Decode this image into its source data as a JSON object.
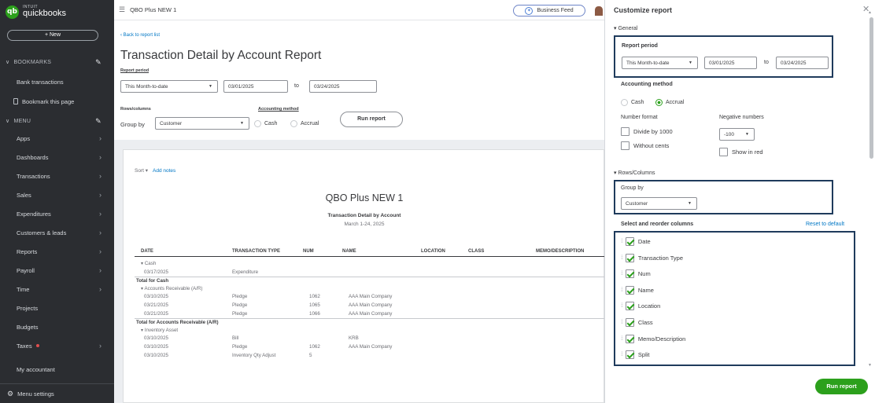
{
  "sidebar": {
    "logo_small": "INTUIT",
    "logo_main": "quickbooks",
    "new_label": "+ New",
    "bookmarks_label": "BOOKMARKS",
    "bookmarks_items": [
      "Bank transactions",
      "Bookmark this page"
    ],
    "menu_label": "MENU",
    "menu_items": [
      "Apps",
      "Dashboards",
      "Transactions",
      "Sales",
      "Expenditures",
      "Customers & leads",
      "Reports",
      "Payroll",
      "Time",
      "Projects",
      "Budgets",
      "Taxes",
      "My accountant"
    ],
    "settings_label": "Menu settings"
  },
  "topbar": {
    "company": "QBO Plus NEW 1",
    "business_feed": "Business Feed"
  },
  "report": {
    "back_link": "Back to report list",
    "title": "Transaction Detail by Account Report",
    "period_label": "Report period",
    "period_value": "This Month-to-date",
    "from_date": "03/01/2025",
    "to_label": "to",
    "to_date": "03/24/2025",
    "rows_columns_label": "Rows/columns",
    "group_by_label": "Group by",
    "group_by_value": "Customer",
    "accounting_method_label": "Accounting method",
    "cash_label": "Cash",
    "accrual_label": "Accrual",
    "run_label": "Run report",
    "sort_label": "Sort ▾",
    "add_notes": "Add notes",
    "company_name": "QBO Plus NEW 1",
    "report_name": "Transaction Detail by Account",
    "date_range": "March 1-24, 2025",
    "columns": [
      "DATE",
      "TRANSACTION TYPE",
      "NUM",
      "NAME",
      "LOCATION",
      "CLASS",
      "MEMO/DESCRIPTION"
    ],
    "rows": [
      {
        "date": "▾ Cash",
        "type": "",
        "num": "",
        "name": "",
        "kind": "group"
      },
      {
        "date": "03/17/2025",
        "type": "Expenditure",
        "num": "",
        "name": "",
        "kind": "data"
      },
      {
        "date": "Total for Cash",
        "type": "",
        "num": "",
        "name": "",
        "kind": "total"
      },
      {
        "date": "▾ Accounts Receivable (A/R)",
        "type": "",
        "num": "",
        "name": "",
        "kind": "group"
      },
      {
        "date": "03/10/2025",
        "type": "Pledge",
        "num": "1062",
        "name": "AAA Main Company",
        "kind": "data"
      },
      {
        "date": "03/21/2025",
        "type": "Pledge",
        "num": "1065",
        "name": "AAA Main Company",
        "kind": "data"
      },
      {
        "date": "03/21/2025",
        "type": "Pledge",
        "num": "1066",
        "name": "AAA Main Company",
        "kind": "data"
      },
      {
        "date": "Total for Accounts Receivable (A/R)",
        "type": "",
        "num": "",
        "name": "",
        "kind": "total"
      },
      {
        "date": "▾ Inventory Asset",
        "type": "",
        "num": "",
        "name": "",
        "kind": "group"
      },
      {
        "date": "03/10/2025",
        "type": "Bill",
        "num": "",
        "name": "KRB",
        "kind": "data"
      },
      {
        "date": "03/10/2025",
        "type": "Pledge",
        "num": "1062",
        "name": "AAA Main Company",
        "kind": "data"
      },
      {
        "date": "03/10/2025",
        "type": "Inventory Qty Adjust",
        "num": "5",
        "name": "",
        "kind": "data"
      }
    ]
  },
  "panel": {
    "title": "Customize report",
    "general_label": "▾ General",
    "period_label": "Report period",
    "period_value": "This Month-to-date",
    "from_date": "03/01/2025",
    "to_label": "to",
    "to_date": "03/24/2025",
    "accounting_method_label": "Accounting method",
    "cash_label": "Cash",
    "accrual_label": "Accrual",
    "number_format_label": "Number format",
    "divide_label": "Divide by 1000",
    "without_cents_label": "Without cents",
    "negative_label": "Negative numbers",
    "negative_value": "-100",
    "show_red_label": "Show in red",
    "rows_columns_label": "▾ Rows/Columns",
    "group_by_label": "Group by",
    "group_by_value": "Customer",
    "select_columns_label": "Select and reorder columns",
    "reset_label": "Reset to default",
    "columns": [
      "Date",
      "Transaction Type",
      "Num",
      "Name",
      "Location",
      "Class",
      "Memo/Description",
      "Split"
    ],
    "run_label": "Run report"
  }
}
